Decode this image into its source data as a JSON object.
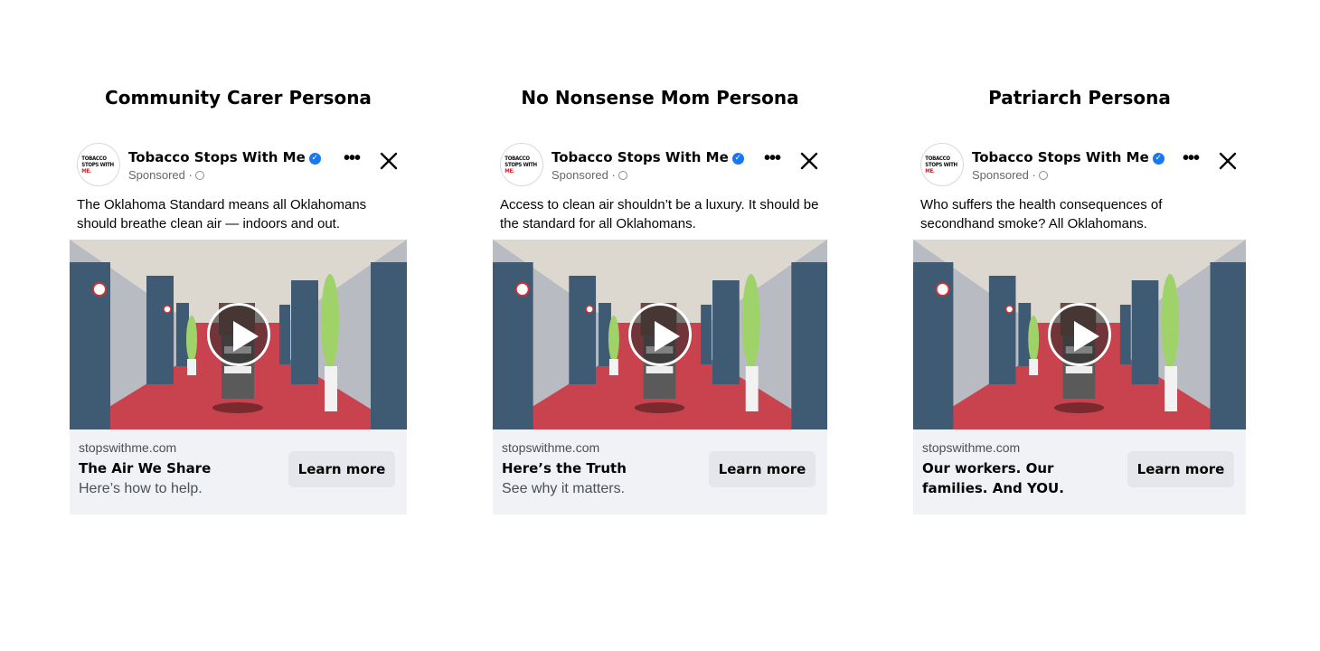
{
  "ads": [
    {
      "persona": "Community Carer Persona",
      "page_name": "Tobacco Stops With Me",
      "sponsored": "Sponsored ·",
      "body_text": "The Oklahoma Standard means all Oklahomans should breathe clean air — indoors and out.",
      "domain": "stopswithme.com",
      "headline": "The Air We Share",
      "description": "Here’s how to help.",
      "cta": "Learn more",
      "logo_line1": "TOBACCO",
      "logo_line2": "STOPS WITH",
      "logo_line3": "ME."
    },
    {
      "persona": "No Nonsense Mom Persona",
      "page_name": "Tobacco Stops With Me",
      "sponsored": "Sponsored ·",
      "body_text": "Access to clean air shouldn’t be a luxury. It should be the standard for all Oklahomans.",
      "domain": "stopswithme.com",
      "headline": "Here’s the Truth",
      "description": "See why it matters.",
      "cta": "Learn more",
      "logo_line1": "TOBACCO",
      "logo_line2": "STOPS WITH",
      "logo_line3": "ME."
    },
    {
      "persona": "Patriarch Persona",
      "page_name": "Tobacco Stops With Me",
      "sponsored": "Sponsored ·",
      "body_text": "Who suffers the health consequences of secondhand smoke? All Oklahomans.",
      "domain": "stopswithme.com",
      "headline": "Our workers. Our families. And YOU.",
      "description": "",
      "cta": "Learn more",
      "logo_line1": "TOBACCO",
      "logo_line2": "STOPS WITH",
      "logo_line3": "ME."
    }
  ],
  "colors": {
    "verified_badge": "#1877f2",
    "carpet": "#c9434f",
    "doors": "#3f5b74",
    "footer_bg": "#f0f2f5"
  },
  "icons": [
    "verified-badge-icon",
    "globe-icon",
    "more-options-icon",
    "close-icon",
    "play-icon"
  ]
}
